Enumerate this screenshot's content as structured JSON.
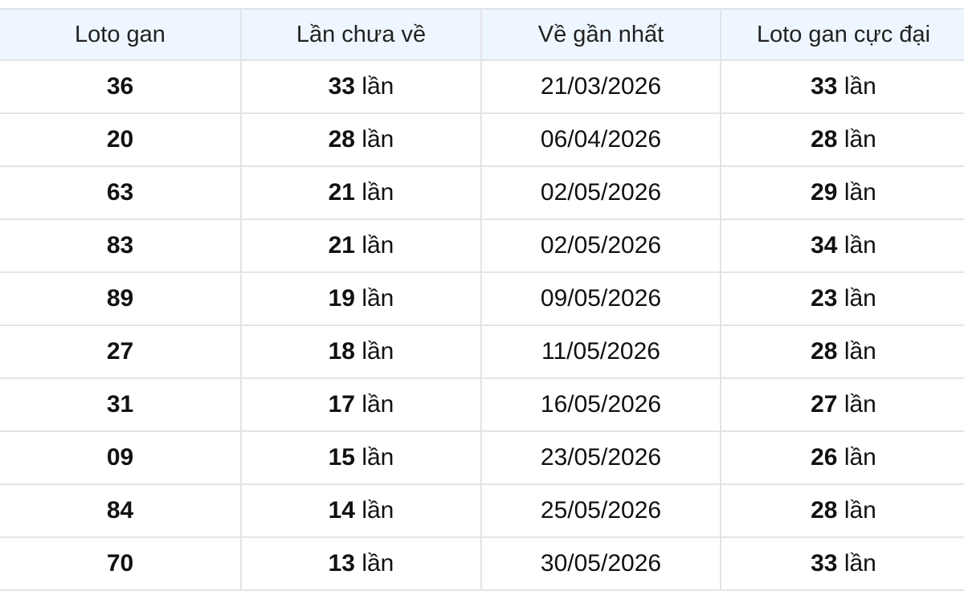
{
  "table": {
    "columns": [
      "Loto gan",
      "Lần chưa về",
      "Về gần nhất",
      "Loto gan cực đại"
    ],
    "unit": "lần",
    "rows": [
      {
        "loto": "36",
        "misses": "33",
        "last": "21/03/2026",
        "max": "33"
      },
      {
        "loto": "20",
        "misses": "28",
        "last": "06/04/2026",
        "max": "28"
      },
      {
        "loto": "63",
        "misses": "21",
        "last": "02/05/2026",
        "max": "29"
      },
      {
        "loto": "83",
        "misses": "21",
        "last": "02/05/2026",
        "max": "34"
      },
      {
        "loto": "89",
        "misses": "19",
        "last": "09/05/2026",
        "max": "23"
      },
      {
        "loto": "27",
        "misses": "18",
        "last": "11/05/2026",
        "max": "28"
      },
      {
        "loto": "31",
        "misses": "17",
        "last": "16/05/2026",
        "max": "27"
      },
      {
        "loto": "09",
        "misses": "15",
        "last": "23/05/2026",
        "max": "26"
      },
      {
        "loto": "84",
        "misses": "14",
        "last": "25/05/2026",
        "max": "28"
      },
      {
        "loto": "70",
        "misses": "13",
        "last": "30/05/2026",
        "max": "33"
      }
    ]
  },
  "colors": {
    "header_bg": "#eef6ff",
    "border": "#e2e4e8",
    "date_link": "#2b44c4"
  }
}
